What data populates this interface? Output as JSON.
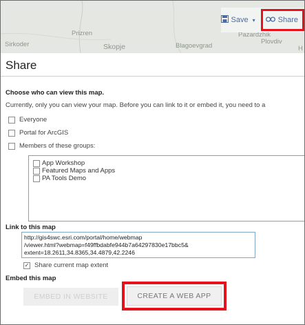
{
  "map": {
    "labels": [
      "Prizren",
      "Sirkoder",
      "Skopje",
      "Blagoevgrad",
      "Pazardzhik",
      "Plovdiv",
      "H"
    ]
  },
  "toolbar": {
    "save_label": "Save",
    "share_label": "Share",
    "save_icon": "save-icon",
    "share_icon": "link-icon"
  },
  "dialog": {
    "title": "Share",
    "who_heading": "Choose who can view this map.",
    "info_text": "Currently, only you can view your map. Before you can link to it or embed it, you need to a",
    "options": [
      {
        "label": "Everyone",
        "checked": false
      },
      {
        "label": "Portal for ArcGIS",
        "checked": false
      },
      {
        "label": "Members of these groups:",
        "checked": false
      }
    ],
    "groups": [
      {
        "label": "App Workshop",
        "checked": false
      },
      {
        "label": "Featured Maps and Apps",
        "checked": false
      },
      {
        "label": "PA Tools Demo",
        "checked": false
      }
    ],
    "link_heading": "Link to this map",
    "link_lines": [
      "http://gis4swc.esri.com/portal/home/webmap",
      "/viewer.html?webmap=f49ffbdabfe944b7a64297830e17bbc5&",
      "extent=18.2611,34.8365,34.4879,42.2246"
    ],
    "share_extent_label": "Share current map extent",
    "share_extent_checked": true,
    "embed_heading": "Embed this map",
    "embed_button": "EMBED IN WEBSITE",
    "create_app_button": "CREATE A WEB APP"
  },
  "colors": {
    "highlight": "#e5121e",
    "link_text": "#4c6ba0"
  }
}
